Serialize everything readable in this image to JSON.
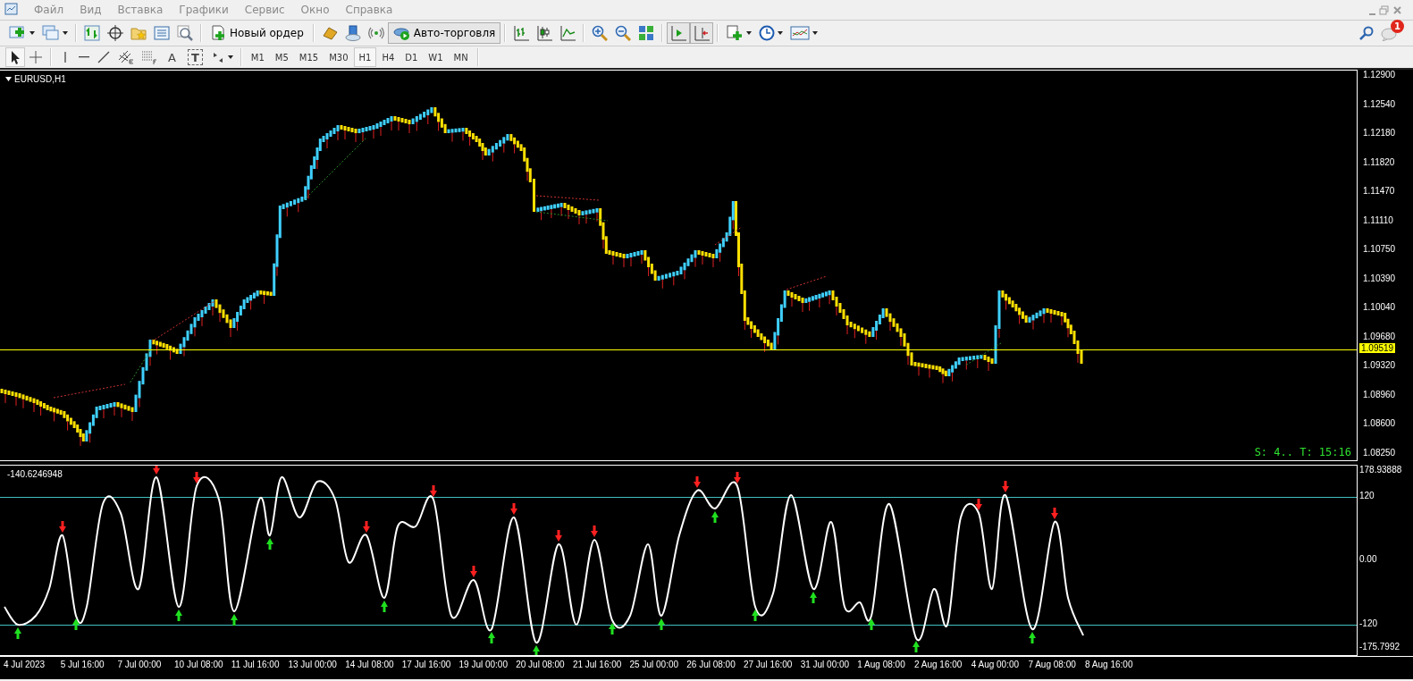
{
  "menu": [
    "Файл",
    "Вид",
    "Вставка",
    "Графики",
    "Сервис",
    "Окно",
    "Справка"
  ],
  "toolbar": {
    "new_order": "Новый ордер",
    "auto_trading": {
      "label": "Авто-торговля",
      "on": true
    },
    "notifications": "1"
  },
  "drawing_tools": [
    "A",
    "T"
  ],
  "timeframes": [
    {
      "label": "M1",
      "selected": false
    },
    {
      "label": "M5",
      "selected": false
    },
    {
      "label": "M15",
      "selected": false
    },
    {
      "label": "M30",
      "selected": false
    },
    {
      "label": "H1",
      "selected": true
    },
    {
      "label": "H4",
      "selected": false
    },
    {
      "label": "D1",
      "selected": false
    },
    {
      "label": "W1",
      "selected": false
    },
    {
      "label": "MN",
      "selected": false
    }
  ],
  "chart": {
    "symbol": "EURUSD,H1",
    "price_ticks": [
      "1.12900",
      "1.12540",
      "1.12180",
      "1.11820",
      "1.11470",
      "1.11110",
      "1.10750",
      "1.10390",
      "1.10040",
      "1.09680",
      "1.09320",
      "1.08960",
      "1.08600",
      "1.08250"
    ],
    "current_price": "1.09519",
    "status": "S: 4.. T: 15:16"
  },
  "indicator": {
    "value": "-140.6246948",
    "ticks": [
      "178.93888",
      "120",
      "0.00",
      "-120",
      "-175.7992"
    ]
  },
  "time_axis": [
    "4 Jul 2023",
    "5 Jul 16:00",
    "7 Jul 00:00",
    "10 Jul 08:00",
    "11 Jul 16:00",
    "13 Jul 00:00",
    "14 Jul 08:00",
    "17 Jul 16:00",
    "19 Jul 00:00",
    "20 Jul 08:00",
    "21 Jul 16:00",
    "25 Jul 00:00",
    "26 Jul 08:00",
    "27 Jul 16:00",
    "31 Jul 00:00",
    "1 Aug 08:00",
    "2 Aug 16:00",
    "4 Aug 00:00",
    "7 Aug 08:00",
    "8 Aug 16:00"
  ]
}
